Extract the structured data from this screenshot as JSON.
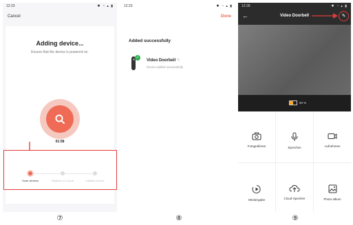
{
  "screens": [
    {
      "status_time": "12:23",
      "cancel_label": "Cancel",
      "title": "Adding device...",
      "subtitle": "Ensure that the device is powered on.",
      "timer": "01:58",
      "steps": [
        "Scan devices",
        "Register on Cloud",
        "Initialize device"
      ]
    },
    {
      "status_time": "12:23",
      "done_label": "Done",
      "section_title": "Added successfully",
      "device_name": "Video Doorbell",
      "device_status": "Device added successfully"
    },
    {
      "status_time": "12:28",
      "title": "Video Doorbell",
      "battery_text": "50 %",
      "controls": [
        "Fotografieren",
        "Sprechen",
        "Aufnehmen",
        "Wiedergabe",
        "Cloud-Speicher",
        "Photo album"
      ]
    }
  ],
  "figure_labels": [
    "⑦",
    "⑧",
    "⑨"
  ],
  "colors": {
    "accent": "#ef6b56",
    "annotation": "#e23b3b",
    "success": "#2bb24c",
    "dark_bar": "#2c2c2c",
    "battery": "#f5a623"
  }
}
